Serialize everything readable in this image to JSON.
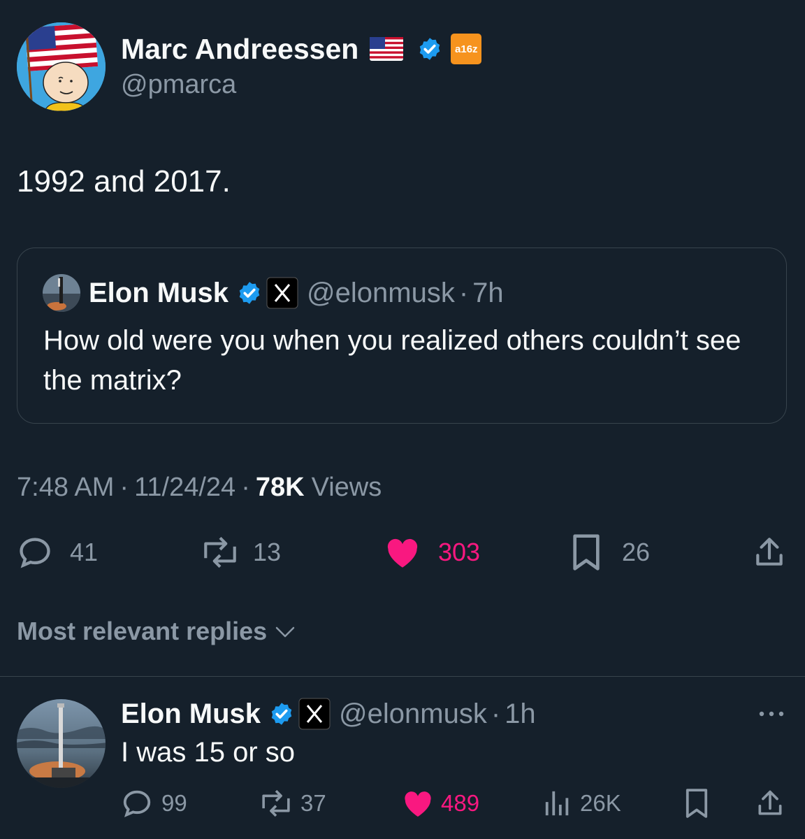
{
  "main_tweet": {
    "author_name": "Marc Andreessen",
    "author_handle": "@pmarca",
    "affiliate_badge": "a16z",
    "text": "1992 and 2017.",
    "timestamp": "7:48 AM",
    "date": "11/24/24",
    "views_count": "78K",
    "views_label": "Views",
    "separator": "·",
    "stats": {
      "replies": "41",
      "reposts": "13",
      "likes": "303",
      "bookmarks": "26"
    }
  },
  "quoted_tweet": {
    "author_name": "Elon Musk",
    "author_handle": "@elonmusk",
    "age": "7h",
    "text": "How old were you when you realized others couldn’t see the matrix?"
  },
  "replies_filter": {
    "label": "Most relevant replies"
  },
  "reply": {
    "author_name": "Elon Musk",
    "author_handle": "@elonmusk",
    "age": "1h",
    "text": "I was 15 or so",
    "stats": {
      "replies": "99",
      "reposts": "37",
      "likes": "489",
      "views": "26K"
    }
  },
  "colors": {
    "background": "#15202b",
    "muted": "#8b98a5",
    "like_pink": "#f91880",
    "verified_blue": "#1d9bf0",
    "border": "#38444d"
  }
}
